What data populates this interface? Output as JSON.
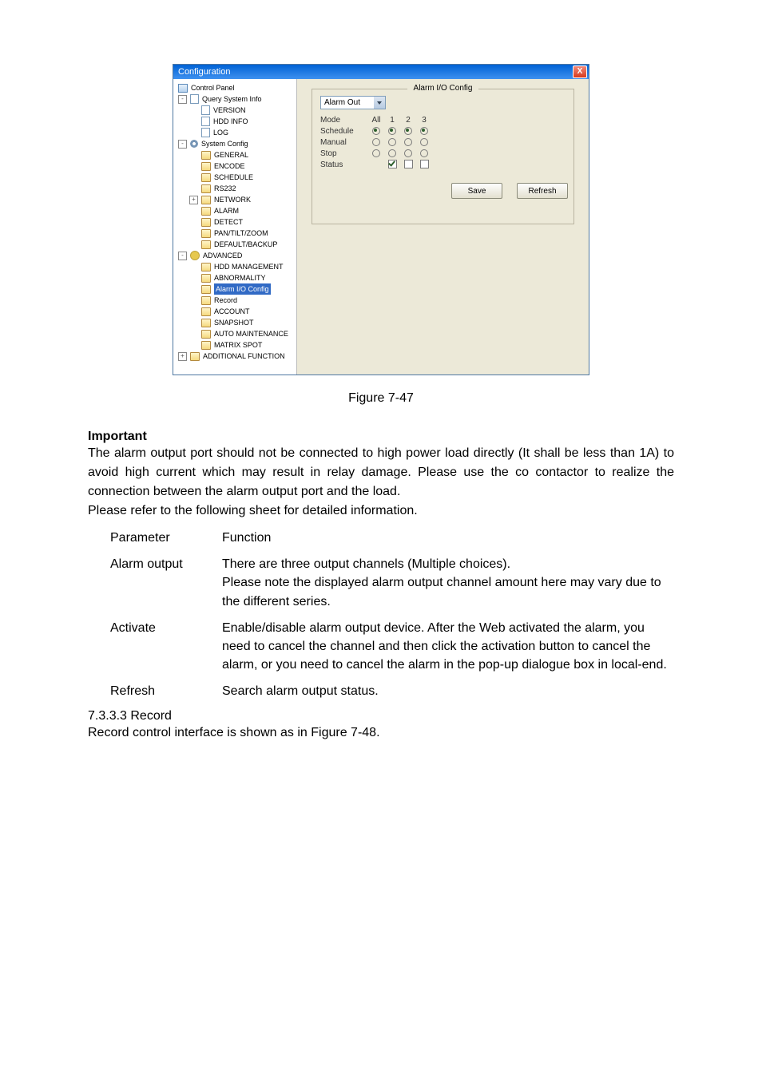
{
  "window": {
    "title": "Configuration",
    "close": "X",
    "tree": {
      "control_panel": "Control Panel",
      "query": "Query System Info",
      "version": "VERSION",
      "hdd_info": "HDD INFO",
      "log": "LOG",
      "sysconf": "System Config",
      "general": "GENERAL",
      "encode": "ENCODE",
      "schedule": "SCHEDULE",
      "rs232": "RS232",
      "network": "NETWORK",
      "alarm": "ALARM",
      "detect": "DETECT",
      "ptz": "PAN/TILT/ZOOM",
      "default_backup": "DEFAULT/BACKUP",
      "advanced": "ADVANCED",
      "hdd_mgmt": "HDD MANAGEMENT",
      "abnormality": "ABNORMALITY",
      "alarm_io": "Alarm I/O Config",
      "record": "Record",
      "account": "ACCOUNT",
      "snapshot": "SNAPSHOT",
      "auto_maint": "AUTO MAINTENANCE",
      "matrix_spot": "MATRIX SPOT",
      "additional": "ADDITIONAL FUNCTION"
    },
    "group_title": "Alarm I/O Config",
    "dropdown_value": "Alarm Out",
    "labels": {
      "mode": "Mode",
      "schedule": "Schedule",
      "manual": "Manual",
      "stop": "Stop",
      "status": "Status"
    },
    "cols": {
      "all": "All",
      "c1": "1",
      "c2": "2",
      "c3": "3"
    },
    "buttons": {
      "save": "Save",
      "refresh": "Refresh"
    }
  },
  "caption": "Figure 7-47",
  "important_label": "Important",
  "body_p1": "The alarm output port should not be connected to high power load directly (It shall be less than 1A) to avoid high current which may result in relay damage. Please use the co contactor to realize the connection between the alarm output port and the load.",
  "body_p2": "Please refer to the following sheet for detailed information.",
  "table": {
    "h_param": "Parameter",
    "h_func": "Function",
    "r1_name": "Alarm output",
    "r1_func_a": "There are three output channels (Multiple choices).",
    "r1_func_b": "Please note the displayed alarm output channel amount here may vary due to the different series.",
    "r2_name": "Activate",
    "r2_func": "Enable/disable alarm output device. After the Web activated the alarm, you need to cancel the channel and then click the activation button to cancel the alarm, or you need to cancel the alarm in the pop-up dialogue box in local-end.",
    "r3_name": "Refresh",
    "r3_func": "Search alarm output status."
  },
  "section": "7.3.3.3  Record",
  "section_body": "Record control interface is shown as in Figure 7-48."
}
